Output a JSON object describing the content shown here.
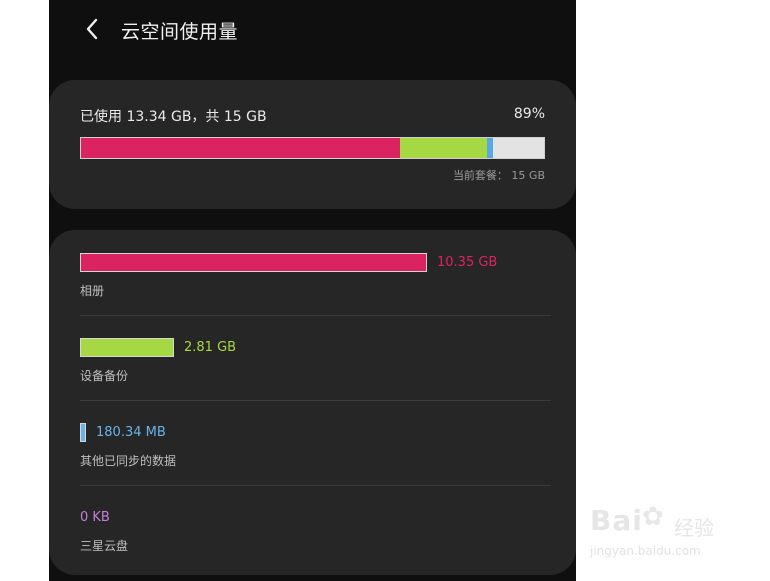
{
  "header": {
    "title": "云空间使用量",
    "back_icon": "chevron-left-icon"
  },
  "summary": {
    "used_text": "已使用 13.34 GB，共 15 GB",
    "percent": "89%",
    "plan_text": "当前套餐： 15 GB",
    "usage_bar": [
      {
        "name": "相册",
        "fraction": 0.69,
        "color": "#dc2361"
      },
      {
        "name": "设备备份",
        "fraction": 0.187,
        "color": "#a6d843"
      },
      {
        "name": "其他已同步的数据",
        "fraction": 0.012,
        "color": "#59a8e6"
      }
    ]
  },
  "categories": [
    {
      "label": "相册",
      "value": "10.35 GB",
      "color": "#dc2361",
      "fraction": 0.862
    },
    {
      "label": "设备备份",
      "value": "2.81 GB",
      "color": "#a6d843",
      "fraction": 0.234
    },
    {
      "label": "其他已同步的数据",
      "value": "180.34 MB",
      "color": "#6ab3ea",
      "fraction": 0.015
    },
    {
      "label": "三星云盘",
      "value": "0 KB",
      "color": "#c47fd6",
      "fraction": 0
    }
  ],
  "watermark": {
    "logo": "Bai",
    "logo_paw": "du",
    "brand": "经验",
    "url": "jingyan.baidu.com"
  }
}
